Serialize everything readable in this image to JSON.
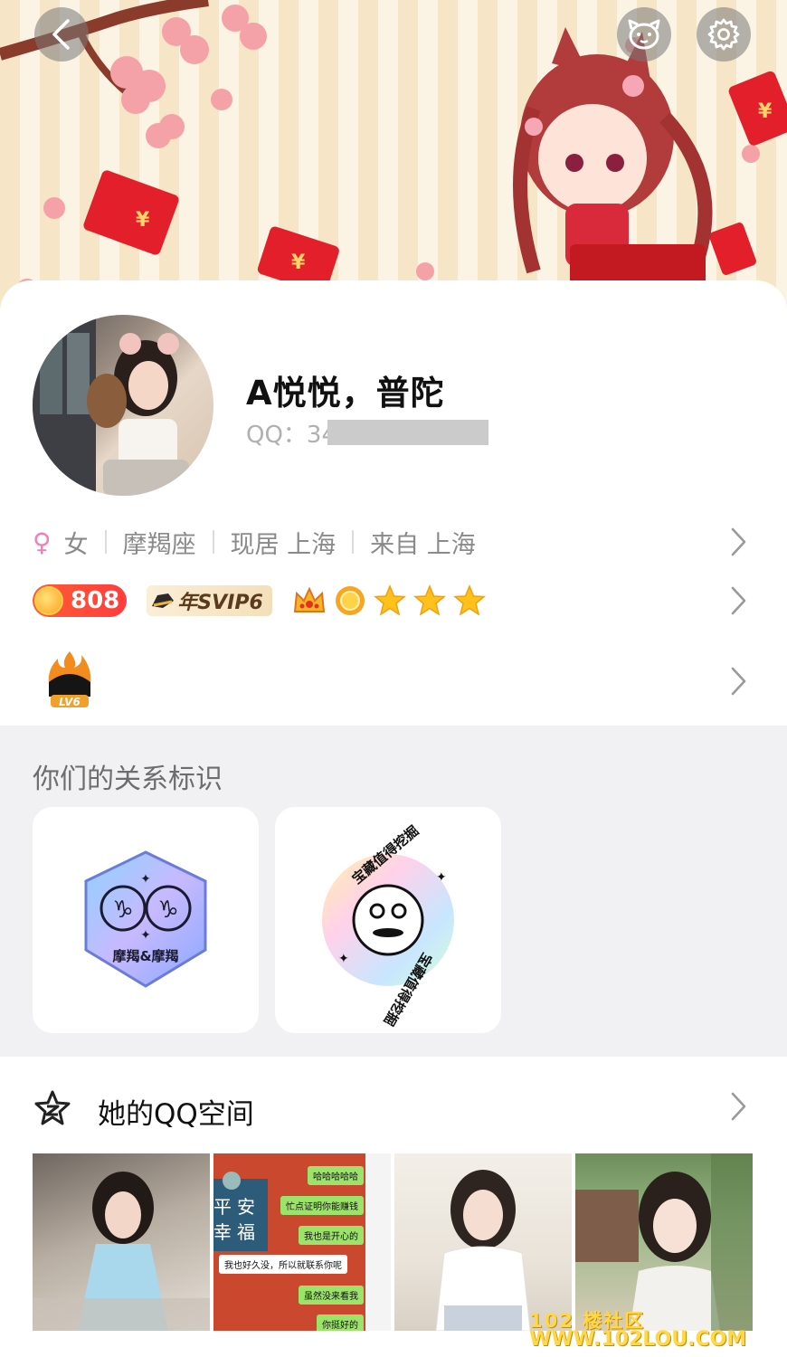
{
  "header": {
    "back_icon": "chevron-left-icon",
    "pet_icon": "pet-face-icon",
    "settings_icon": "gear-icon"
  },
  "profile": {
    "nickname": "A悦悦，普陀",
    "qq_label": "QQ：34",
    "gender_symbol": "♀",
    "gender": "女",
    "zodiac": "摩羯座",
    "current_city": "现居 上海",
    "hometown": "来自 上海"
  },
  "badges": {
    "sun_level": "808",
    "svip": "年SVIP6",
    "level_icons": [
      "crown-icon",
      "sun-icon",
      "star-icon",
      "star-icon",
      "star-icon"
    ],
    "lv_badge": "LV6"
  },
  "relations": {
    "title": "你们的关系标识",
    "cards": [
      {
        "label": "摩羯&摩羯",
        "icon": "capricorn-pair-icon"
      },
      {
        "label": "宝藏值得挖掘",
        "icon": "treasure-face-icon"
      }
    ]
  },
  "qzone": {
    "title": "她的QQ空间",
    "chat_texts": [
      "哈哈哈哈哈",
      "忙点证明你能赚钱",
      "我也是开心的",
      "我也好久没，所以就联系你呢",
      "虽然没来看我",
      "你挺好的"
    ],
    "poster_chars": [
      "平",
      "安",
      "幸",
      "福"
    ]
  },
  "watermark": {
    "line1": "102 楼社区",
    "line2": "WWW.102LOU.COM"
  },
  "colors": {
    "female_pink": "#f27fb6",
    "sun_badge": "#ff4a38",
    "card_bg": "#ffffff",
    "section_bg": "#f1f1f3"
  }
}
